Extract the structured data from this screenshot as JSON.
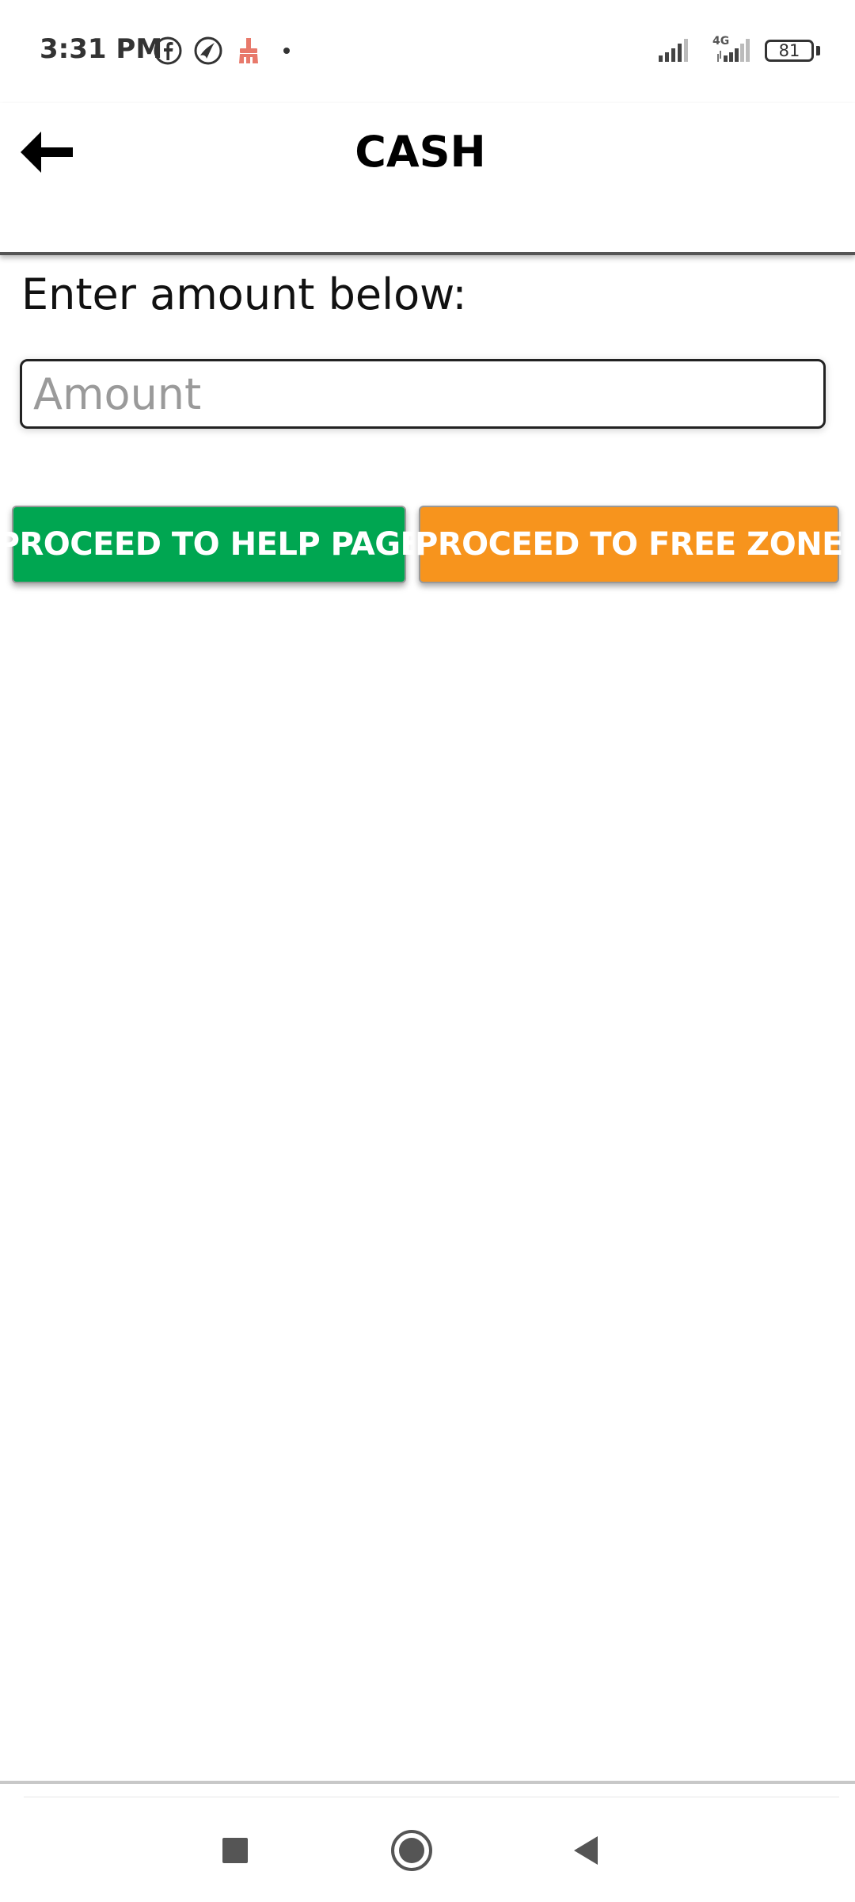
{
  "status_bar": {
    "time": "3:31 PM",
    "icons": [
      "facebook-icon",
      "browser-icon",
      "cleaner-icon",
      "dot-icon"
    ],
    "network_label": "4G",
    "battery_level": "81"
  },
  "header": {
    "title": "CASH",
    "back_icon": "back-arrow-icon"
  },
  "form": {
    "prompt": "Enter amount below:",
    "amount_placeholder": "Amount",
    "amount_value": ""
  },
  "actions": {
    "help_label": "PROCEED TO HELP PAGE",
    "free_zone_label": "PROCEED TO FREE ZONE",
    "help_color": "#00a651",
    "free_zone_color": "#f7941d"
  },
  "nav": {
    "recents_icon": "square-icon",
    "home_icon": "circle-icon",
    "back_icon": "triangle-back-icon"
  }
}
